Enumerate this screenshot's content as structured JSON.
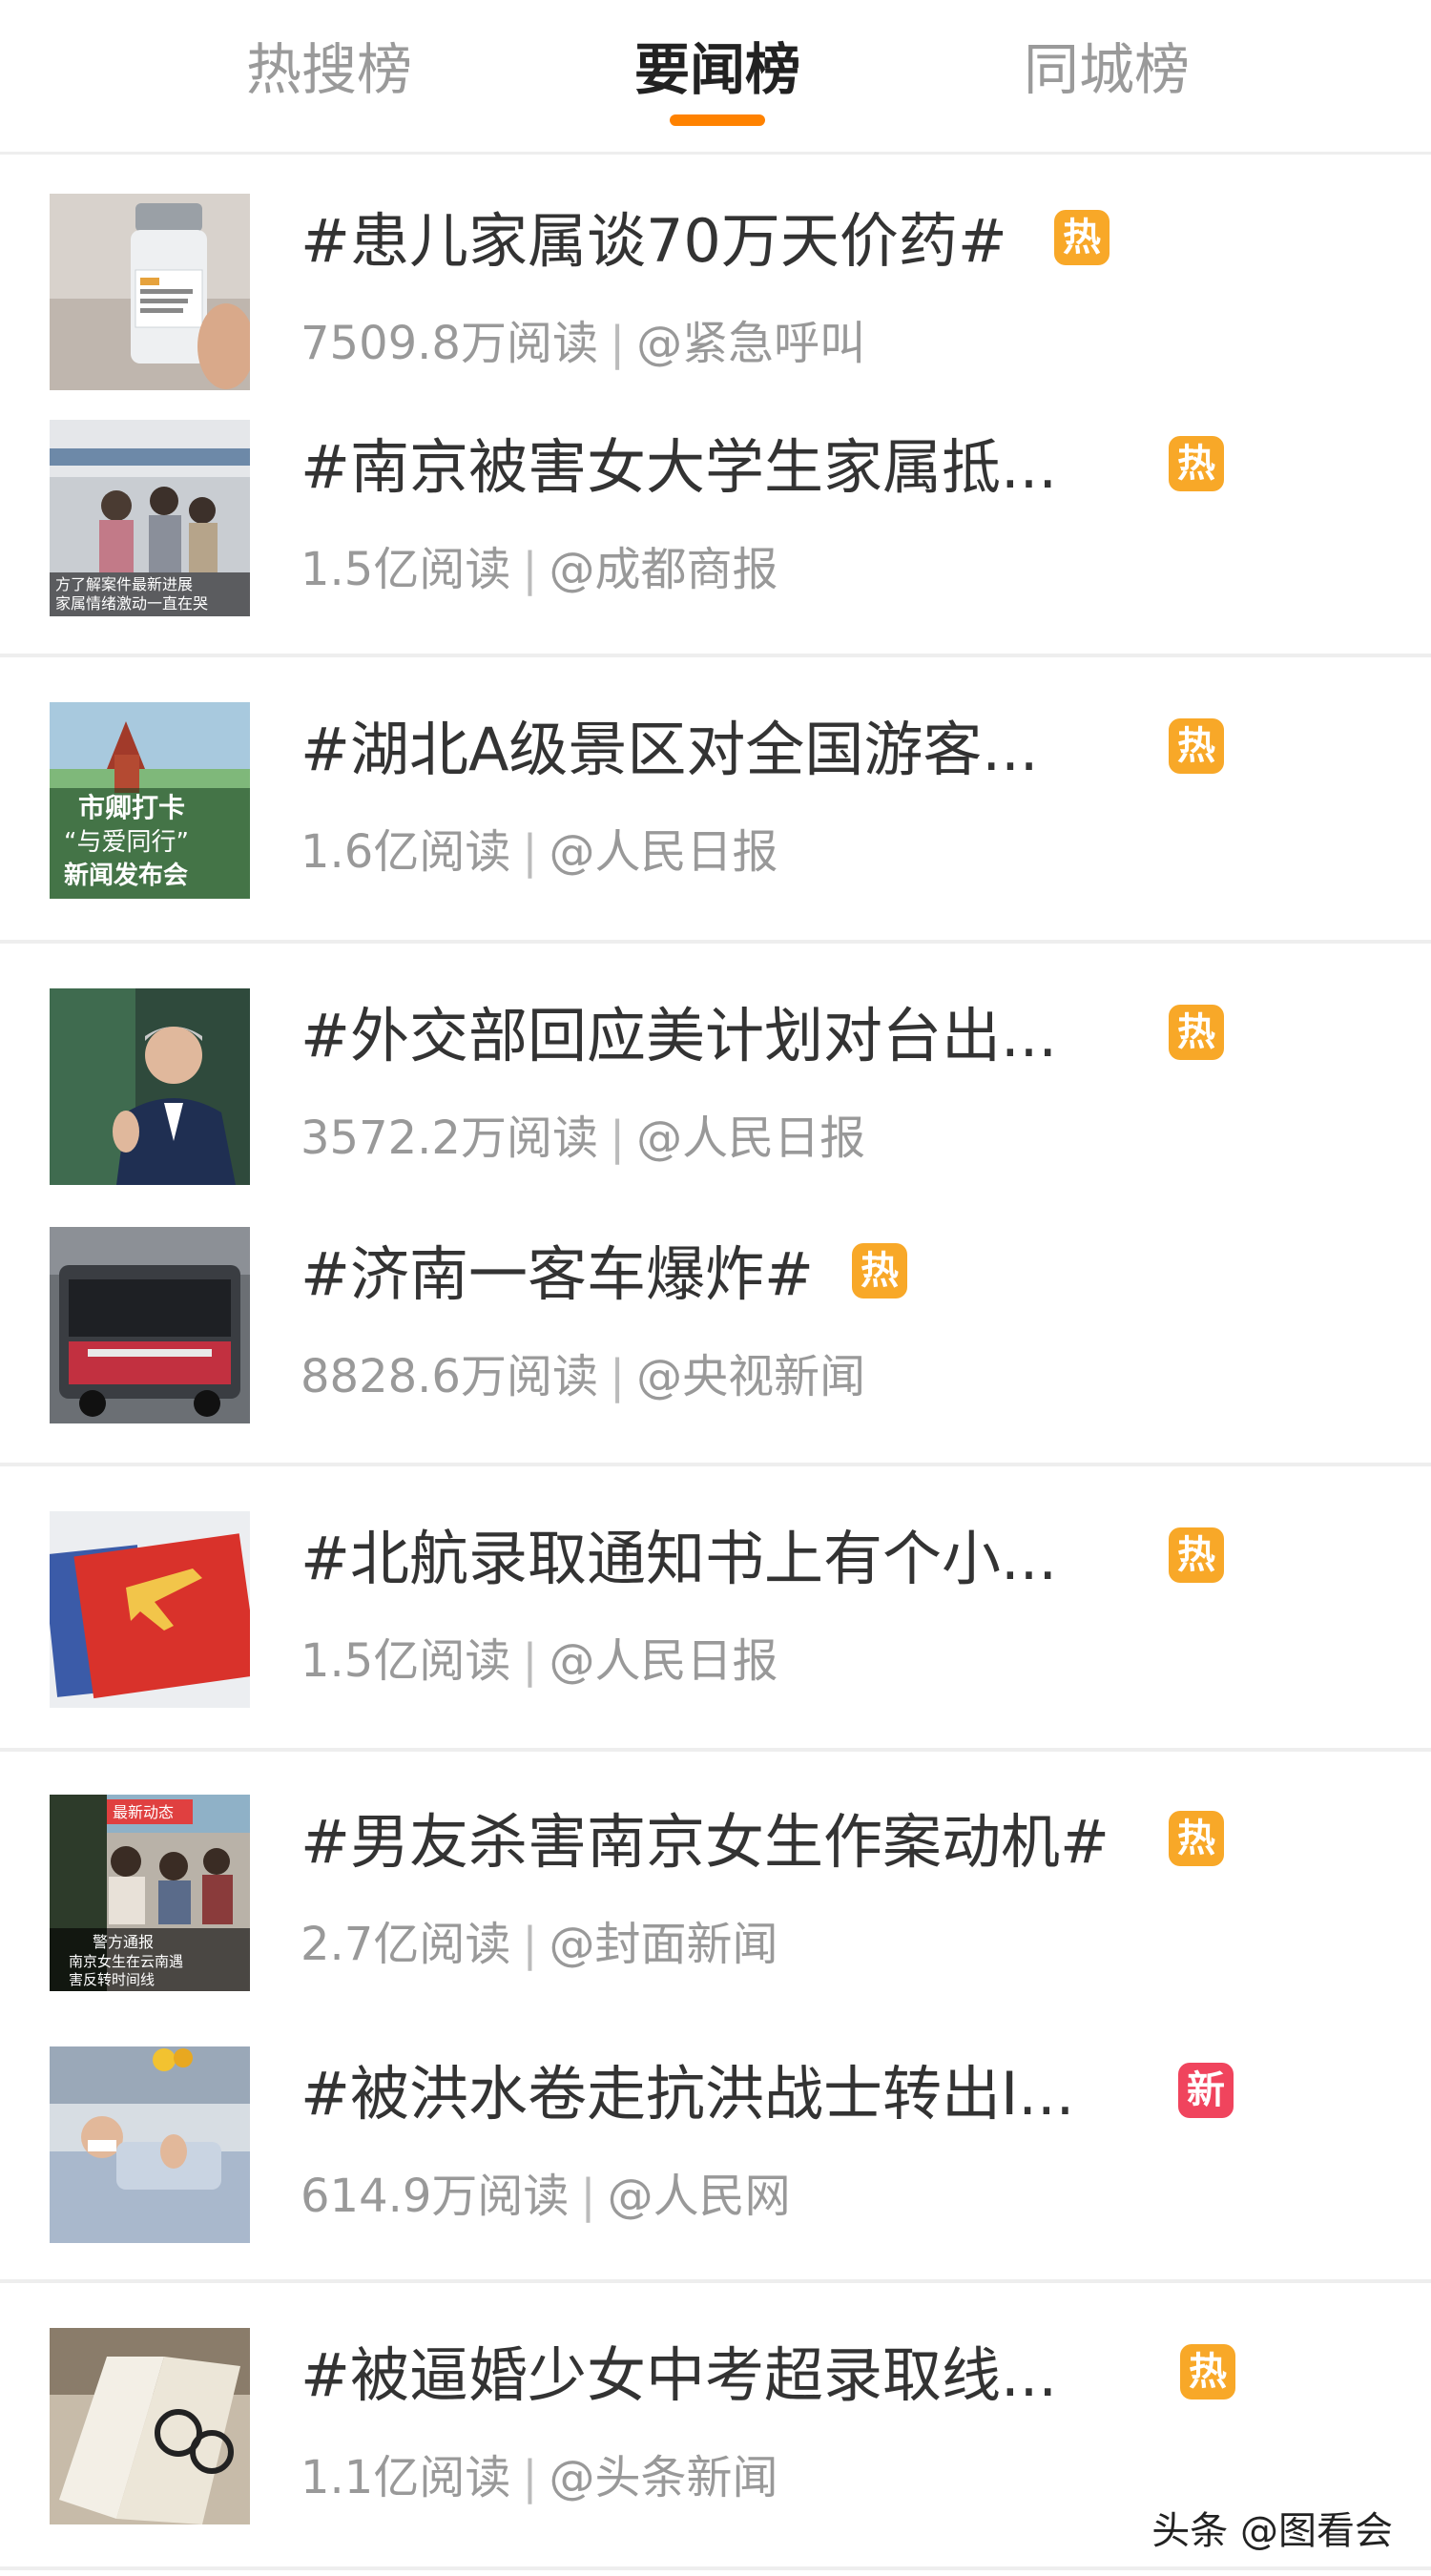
{
  "tabs": [
    {
      "label": "热搜榜"
    },
    {
      "label": "要闻榜"
    },
    {
      "label": "同城榜"
    }
  ],
  "items": [
    {
      "title": "#患儿家属谈70万天价药#",
      "reads": "7509.8万阅读",
      "source": "@紧急呼叫",
      "badge": "热"
    },
    {
      "title": "#南京被害女大学生家属抵...",
      "reads": "1.5亿阅读",
      "source": "@成都商报",
      "badge": "热"
    },
    {
      "title": "#湖北A级景区对全国游客...",
      "reads": "1.6亿阅读",
      "source": "@人民日报",
      "badge": "热"
    },
    {
      "title": "#外交部回应美计划对台出...",
      "reads": "3572.2万阅读",
      "source": "@人民日报",
      "badge": "热"
    },
    {
      "title": "#济南一客车爆炸#",
      "reads": "8828.6万阅读",
      "source": "@央视新闻",
      "badge": "热"
    },
    {
      "title": "#北航录取通知书上有个小...",
      "reads": "1.5亿阅读",
      "source": "@人民日报",
      "badge": "热"
    },
    {
      "title": "#男友杀害南京女生作案动机#",
      "reads": "2.7亿阅读",
      "source": "@封面新闻",
      "badge": "热"
    },
    {
      "title": "#被洪水卷走抗洪战士转出I...",
      "reads": "614.9万阅读",
      "source": "@人民网",
      "badge": "新"
    },
    {
      "title": "#被逼婚少女中考超录取线...",
      "reads": "1.1亿阅读",
      "source": "@头条新闻",
      "badge": "热"
    }
  ],
  "thumb_texts": {
    "item2": [
      "方了解案件最新进展",
      "家属情绪激动一直在哭"
    ],
    "item3": [
      "市卿打卡",
      "“与爱同行”",
      "新闻发布会"
    ],
    "item7": [
      "最新动态",
      "警方通报",
      "南京女生在云南遇",
      "害反转时间线"
    ]
  },
  "separator": "|",
  "watermark": "头条 @图看会",
  "colors": {
    "accent": "#ff8200",
    "hot": "#f8a828",
    "new": "#f0445d",
    "muted": "#999999"
  }
}
